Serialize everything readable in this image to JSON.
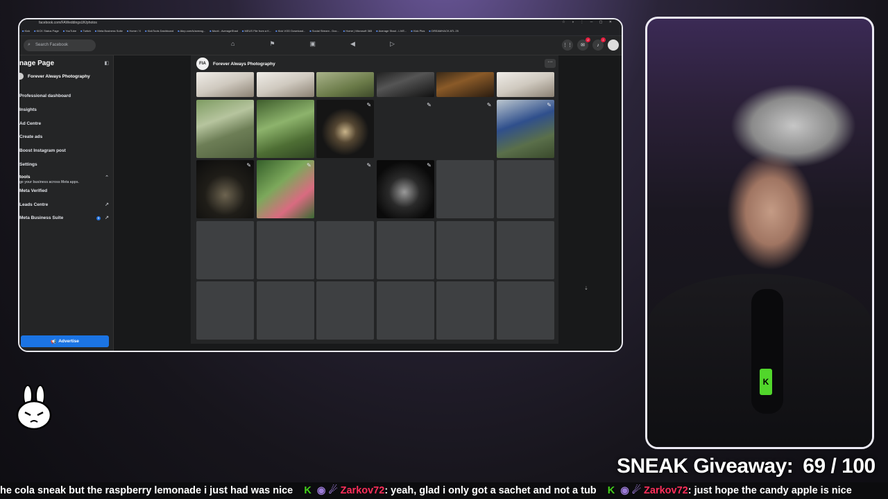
{
  "browser": {
    "url": "facebook.com/FAWeddingsUK/photos",
    "bookmarks": [
      "Kick",
      "KICK Status Page",
      "YouTube",
      "Twitch",
      "Meta Business Suite",
      "Home / X",
      "KickTools Dashboard",
      "Akrp.com/k/averag...",
      "Mooti - AverageShad",
      "MEUS File from a K...",
      "Kick VOD Download...",
      "Social Stream - Doc...",
      "Home | Microsoft 365",
      "Average Shad - LIVE...",
      "Kick Plus",
      "DREAMHACK ATL 25"
    ]
  },
  "facebook": {
    "search_placeholder": "Search Facebook",
    "sidebar": {
      "title": "nage Page",
      "page_name": "Forever Always Photography",
      "items": [
        {
          "label": "Professional dashboard"
        },
        {
          "label": "Insights"
        },
        {
          "label": "Ad Centre"
        },
        {
          "label": "Create ads"
        },
        {
          "label": "Boost Instagram post"
        },
        {
          "label": "Settings"
        }
      ],
      "tools_title": "tools",
      "tools_subtitle": "ge your business across Meta apps.",
      "tools_items": [
        {
          "label": "Meta Verified"
        },
        {
          "label": "Leads Centre"
        },
        {
          "label": "Meta Business Suite",
          "badge": "5"
        }
      ],
      "advertise_label": "Advertise"
    },
    "page_header": {
      "avatar_initials": "FIA",
      "name": "Forever Always Photography",
      "more_label": "···"
    },
    "photo_rows": [
      [
        "ph-light",
        "ph-light",
        "ph-field",
        "ph-dark",
        "ph-warm",
        "ph-light"
      ],
      [
        "ph-wedding",
        "ph-garden",
        "ph-gazebo",
        "blank-edit",
        "blank-edit",
        "ph-tractor"
      ],
      [
        "ph-night",
        "ph-flowers",
        "blank-edit",
        "ph-bw",
        "empty",
        "empty"
      ],
      [
        "empty",
        "empty",
        "empty",
        "empty",
        "empty",
        "empty"
      ],
      [
        "empty",
        "empty",
        "empty",
        "empty",
        "empty",
        "empty"
      ]
    ]
  },
  "overlay": {
    "giveaway_label": "SNEAK Giveaway:",
    "giveaway_count": "69 / 100",
    "giveaway_progress": 0.69,
    "ticker": {
      "msg1": "he cola sneak but the raspberry lemonade i just had was nice",
      "user2": "Zarkov72",
      "msg2": ": yeah, glad i only got a sachet and not a tub",
      "user3": "Zarkov72",
      "msg3": ": just hope the candy apple is nice"
    }
  }
}
